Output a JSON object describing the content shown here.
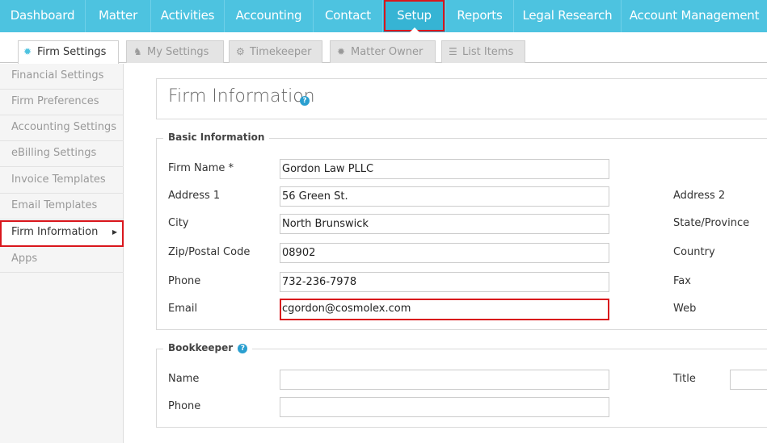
{
  "topnav": {
    "items": [
      {
        "label": "Dashboard"
      },
      {
        "label": "Matter"
      },
      {
        "label": "Activities"
      },
      {
        "label": "Accounting"
      },
      {
        "label": "Contact"
      },
      {
        "label": "Setup",
        "active": true
      },
      {
        "label": "Reports"
      },
      {
        "label": "Legal Research"
      },
      {
        "label": "Account Management"
      }
    ]
  },
  "subtabs": [
    {
      "label": "Firm Settings",
      "icon": "gear-icon",
      "active": true
    },
    {
      "label": "My Settings",
      "icon": "person-icon"
    },
    {
      "label": "Timekeeper",
      "icon": "gears-icon"
    },
    {
      "label": "Matter Owner",
      "icon": "gear-icon"
    },
    {
      "label": "List Items",
      "icon": "list-icon"
    }
  ],
  "sidebar": {
    "items": [
      {
        "label": "Financial Settings"
      },
      {
        "label": "Firm Preferences"
      },
      {
        "label": "Accounting Settings"
      },
      {
        "label": "eBilling Settings"
      },
      {
        "label": "Invoice Templates"
      },
      {
        "label": "Email Templates"
      },
      {
        "label": "Firm Information",
        "active": true
      },
      {
        "label": "Apps"
      }
    ]
  },
  "page": {
    "title": "Firm Information",
    "help": "?"
  },
  "basic": {
    "legend": "Basic Information",
    "firm_name_label": "Firm Name *",
    "firm_name": "Gordon Law PLLC",
    "address1_label": "Address 1",
    "address1": "56 Green St.",
    "city_label": "City",
    "city": "North Brunswick",
    "zip_label": "Zip/Postal Code",
    "zip": "08902",
    "phone_label": "Phone",
    "phone": "732-236-7978",
    "email_label": "Email",
    "email": "cgordon@cosmolex.com",
    "address2_label": "Address 2",
    "state_label": "State/Province",
    "country_label": "Country",
    "fax_label": "Fax",
    "web_label": "Web"
  },
  "bookkeeper": {
    "legend": "Bookkeeper",
    "help": "?",
    "name_label": "Name",
    "name": "",
    "phone_label": "Phone",
    "phone": "",
    "title_label": "Title",
    "title": ""
  },
  "colors": {
    "accent": "#4dc3e0",
    "highlight": "#d9161c",
    "help": "#2a9fd0"
  }
}
